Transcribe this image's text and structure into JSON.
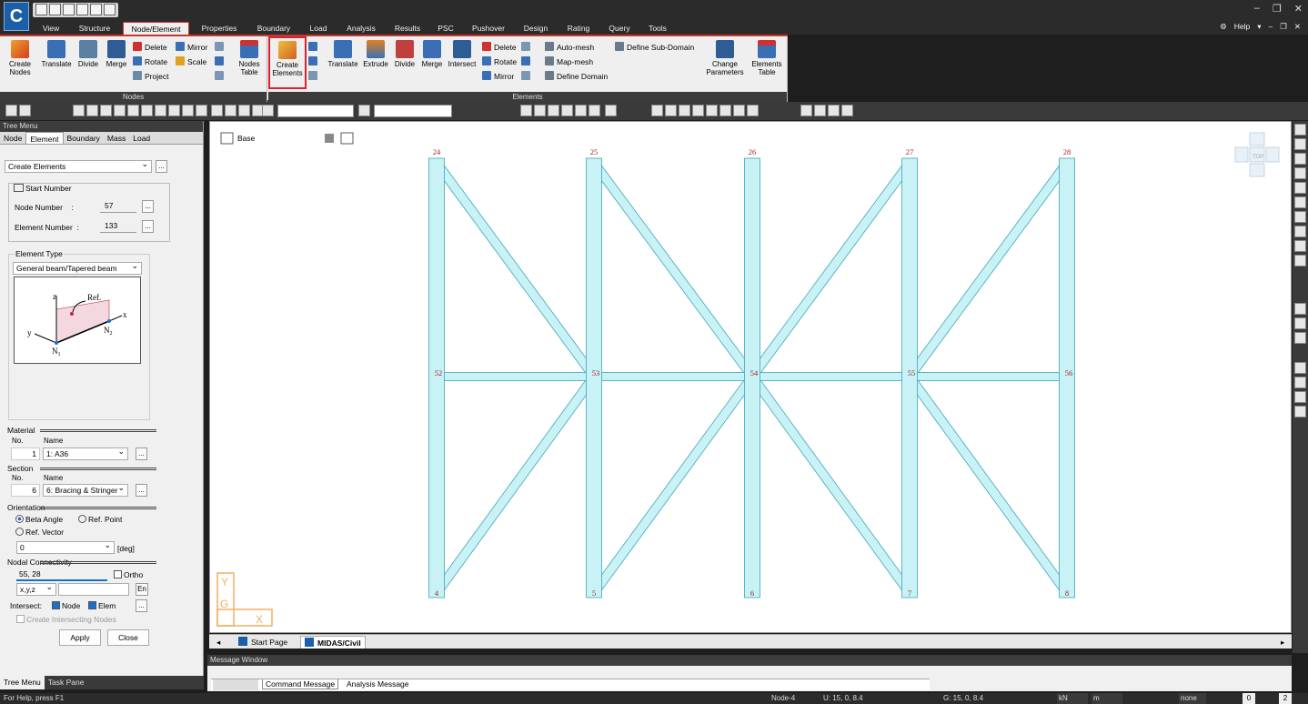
{
  "menu": {
    "tabs": [
      "View",
      "Structure",
      "Node/Element",
      "Properties",
      "Boundary",
      "Load",
      "Analysis",
      "Results",
      "PSC",
      "Pushover",
      "Design",
      "Rating",
      "Query",
      "Tools"
    ],
    "active": "Node/Element",
    "help": "Help"
  },
  "ribbon": {
    "nodes_group": {
      "label": "Nodes",
      "create_nodes": "Create\nNodes",
      "translate": "Translate",
      "divide": "Divide",
      "merge": "Merge",
      "delete": "Delete",
      "rotate": "Rotate",
      "project": "Project",
      "mirror": "Mirror",
      "scale": "Scale",
      "nodes_table": "Nodes\nTable"
    },
    "elements_group": {
      "label": "Elements",
      "create_elements": "Create\nElements",
      "translate": "Translate",
      "extrude": "Extrude",
      "divide": "Divide",
      "merge": "Merge",
      "intersect": "Intersect",
      "delete": "Delete",
      "rotate": "Rotate",
      "mirror": "Mirror",
      "auto_mesh": "Auto-mesh",
      "map_mesh": "Map-mesh",
      "define_domain": "Define Domain",
      "define_sub_domain": "Define Sub-Domain",
      "change_parameters": "Change\nParameters",
      "elements_table": "Elements\nTable"
    }
  },
  "tree_menu": {
    "title": "Tree Menu",
    "tabs": [
      "Node",
      "Element",
      "Boundary",
      "Mass",
      "Load"
    ],
    "active_tab": "Element",
    "command": "Create Elements",
    "start_number_label": "Start Number",
    "node_number_label": "Node Number",
    "node_number": "57",
    "element_number_label": "Element Number",
    "element_number": "133",
    "element_type_label": "Element Type",
    "element_type": "General beam/Tapered beam",
    "diagram": {
      "z": "z",
      "ref": "Ref.",
      "x": "x",
      "y": "y",
      "n1": "N",
      "n1sub": "1",
      "n2": "N",
      "n2sub": "2"
    },
    "material_label": "Material",
    "no_label": "No.",
    "name_label": "Name",
    "material_no": "1",
    "material_name": "1: A36",
    "section_label": "Section",
    "section_no": "6",
    "section_name": "6: Bracing & Stringer",
    "orientation_label": "Orientation",
    "beta_angle": "Beta Angle",
    "ref_point": "Ref. Point",
    "ref_vector": "Ref. Vector",
    "angle_value": "0",
    "angle_unit": "[deg]",
    "nodal_connectivity_label": "Nodal Connectivity",
    "nodal_connectivity": "55, 28",
    "ortho": "Ortho",
    "coord_mode": "x,y,z",
    "en": "En",
    "intersect_label": "Intersect:",
    "node": "Node",
    "elem": "Elem",
    "create_intersecting_nodes": "Create Intersecting Nodes",
    "apply": "Apply",
    "close": "Close",
    "ellipsis": "..."
  },
  "bottom_tabs": [
    "Tree Menu",
    "Task Pane"
  ],
  "canvas": {
    "story": "Base",
    "view_cube": "TOP",
    "axis_y": "Y",
    "axis_g": "G",
    "axis_x": "X",
    "top_nodes": [
      "24",
      "25",
      "26",
      "27",
      "28"
    ],
    "mid_nodes": [
      "52",
      "53",
      "54",
      "55",
      "56"
    ],
    "bottom_nodes": [
      "4",
      "5",
      "6",
      "7",
      "8"
    ]
  },
  "doc_tabs": [
    "Start Page",
    "MIDAS/Civil"
  ],
  "message_window": {
    "title": "Message Window",
    "tabs": [
      "Command Message",
      "Analysis Message"
    ]
  },
  "status": {
    "help": "For Help, press F1",
    "node": "Node-4",
    "u": "U: 15, 0, 8.4",
    "g": "G: 15, 0, 8.4",
    "force_unit": "kN",
    "length_unit": "m",
    "snap": "none",
    "page_value": "0",
    "page_value2": "2"
  }
}
